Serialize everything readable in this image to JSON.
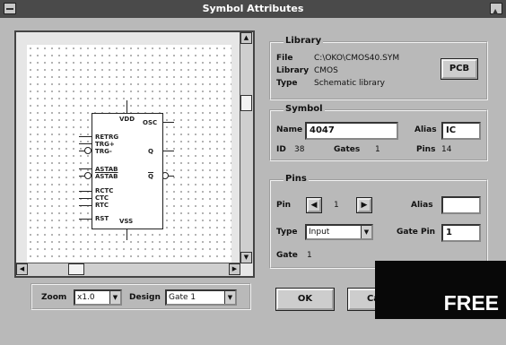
{
  "window": {
    "title": "Symbol Attributes"
  },
  "library": {
    "group_label": "Library",
    "file_label": "File",
    "file_value": "C:\\OKO\\CMOS40.SYM",
    "library_label": "Library",
    "library_value": "CMOS",
    "type_label": "Type",
    "type_value": "Schematic library",
    "pcb_button": "PCB"
  },
  "symbol": {
    "group_label": "Symbol",
    "name_label": "Name",
    "name_value": "4047",
    "alias_label": "Alias",
    "alias_value": "IC",
    "id_label": "ID",
    "id_value": "38",
    "gates_label": "Gates",
    "gates_value": "1",
    "pins_label": "Pins",
    "pins_value": "14"
  },
  "pins": {
    "group_label": "Pins",
    "pin_label": "Pin",
    "pin_value": "1",
    "alias_label": "Alias",
    "alias_value": "",
    "type_label": "Type",
    "type_value": "Input",
    "gate_pin_label": "Gate Pin",
    "gate_pin_value": "1",
    "gate_label": "Gate",
    "gate_value": "1"
  },
  "bottom": {
    "zoom_label": "Zoom",
    "zoom_value": "x1.0",
    "design_label": "Design",
    "design_value": "Gate 1",
    "ok_button": "OK",
    "cancel_button": "Ca"
  },
  "preview": {
    "pins": [
      "VDD",
      "RETRG",
      "TRG+",
      "TRG-",
      "OSC",
      "Q",
      "Q",
      "ASTAB",
      "ASTAB",
      "RCTC",
      "CTC",
      "RTC",
      "RST",
      "VSS"
    ]
  },
  "overlay": {
    "text": "FREE"
  }
}
